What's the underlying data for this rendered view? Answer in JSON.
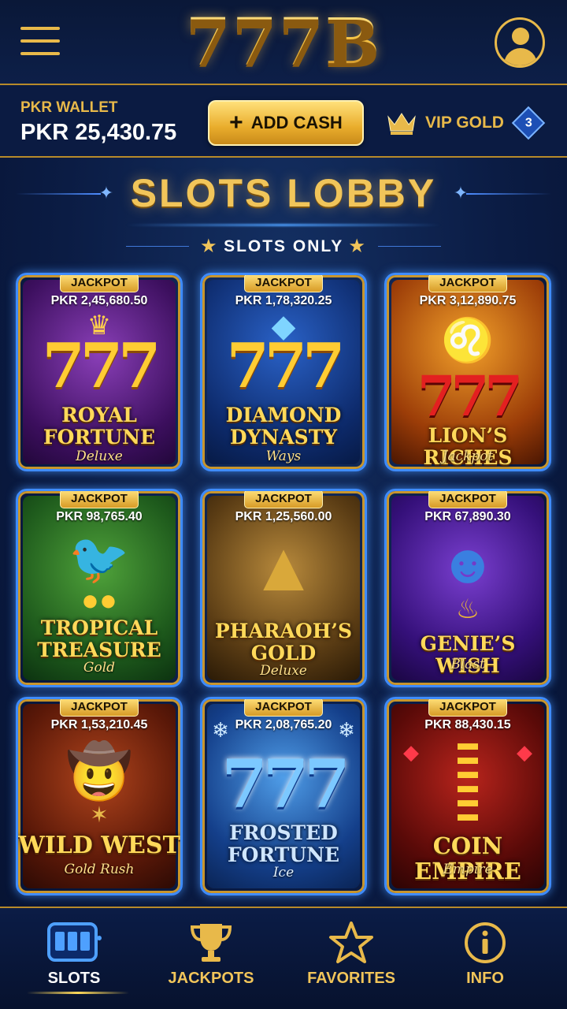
{
  "header": {
    "logo": "777B",
    "menu_icon": "hamburger-menu-icon",
    "profile_icon": "user-profile-icon"
  },
  "wallet": {
    "label": "PKR WALLET",
    "balance": "PKR 25,430.75",
    "add_cash_label": "ADD CASH",
    "vip_label": "VIP GOLD",
    "vip_level": "3"
  },
  "lobby": {
    "title": "SLOTS LOBBY",
    "subtitle": "SLOTS ONLY"
  },
  "games": [
    {
      "badge": "JACKPOT",
      "jackpot": "PKR 2,45,680.50",
      "name_line1": "ROYAL",
      "name_line2": "FORTUNE",
      "sub": "Deluxe"
    },
    {
      "badge": "JACKPOT",
      "jackpot": "PKR 1,78,320.25",
      "name_line1": "DIAMOND",
      "name_line2": "DYNASTY",
      "sub": "Ways"
    },
    {
      "badge": "JACKPOT",
      "jackpot": "PKR 3,12,890.75",
      "name_line1": "LION’S RICHES",
      "name_line2": "",
      "sub": "Jackpot"
    },
    {
      "badge": "JACKPOT",
      "jackpot": "PKR 98,765.40",
      "name_line1": "TROPICAL",
      "name_line2": "TREASURE",
      "sub": "Gold"
    },
    {
      "badge": "JACKPOT",
      "jackpot": "PKR 1,25,560.00",
      "name_line1": "PHARAOH’S",
      "name_line2": "GOLD",
      "sub": "Deluxe"
    },
    {
      "badge": "JACKPOT",
      "jackpot": "PKR 67,890.30",
      "name_line1": "GENIE’S WISH",
      "name_line2": "",
      "sub": "Blast"
    },
    {
      "badge": "JACKPOT",
      "jackpot": "PKR 1,53,210.45",
      "name_line1": "WILD WEST",
      "name_line2": "",
      "sub": "Gold Rush"
    },
    {
      "badge": "JACKPOT",
      "jackpot": "PKR 2,08,765.20",
      "name_line1": "FROSTED",
      "name_line2": "FORTUNE",
      "sub": "Ice"
    },
    {
      "badge": "JACKPOT",
      "jackpot": "PKR 88,430.15",
      "name_line1": "COIN EMPIRE",
      "name_line2": "",
      "sub": "Empire"
    }
  ],
  "tile_art": {
    "sevens_text": "777"
  },
  "nav": {
    "items": [
      {
        "label": "SLOTS",
        "icon": "slot-machine-icon",
        "active": true
      },
      {
        "label": "JACKPOTS",
        "icon": "trophy-icon",
        "active": false
      },
      {
        "label": "FAVORITES",
        "icon": "star-icon",
        "active": false
      },
      {
        "label": "INFO",
        "icon": "info-icon",
        "active": false
      }
    ]
  },
  "colors": {
    "gold": "#f1c55a",
    "background": "#0a1a3d",
    "accent_blue": "#3f8cff"
  }
}
